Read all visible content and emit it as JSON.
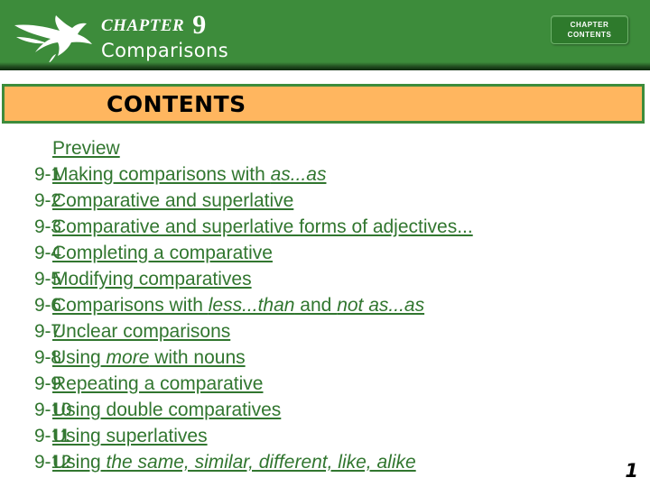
{
  "header": {
    "chapter_word": "CHAPTER",
    "chapter_number": "9",
    "chapter_subject": "Comparisons",
    "background_color": "#3D8C3B",
    "logo_icon": "swallow-bird-icon",
    "contents_button": {
      "line1": "CHAPTER",
      "line2": "CONTENTS"
    }
  },
  "banner": {
    "title": "CONTENTS",
    "background_color": "#FFB65F",
    "border_color": "#3D8C3B"
  },
  "toc": {
    "link_color": "#31762F",
    "items": [
      {
        "number": "",
        "label": "Preview",
        "segments": [
          {
            "text": "Preview",
            "italic": false
          }
        ]
      },
      {
        "number": "9-1",
        "label": "Making comparisons with as...as",
        "segments": [
          {
            "text": "Making comparisons with ",
            "italic": false
          },
          {
            "text": "as...as",
            "italic": true
          }
        ]
      },
      {
        "number": "9-2",
        "label": "Comparative and superlative",
        "segments": [
          {
            "text": "Comparative and superlative",
            "italic": false
          }
        ]
      },
      {
        "number": "9-3",
        "label": "Comparative and superlative forms of adjectives...",
        "segments": [
          {
            "text": "Comparative and superlative forms of adjectives...",
            "italic": false
          }
        ]
      },
      {
        "number": "9-4",
        "label": "Completing a comparative",
        "segments": [
          {
            "text": "Completing a comparative",
            "italic": false
          }
        ]
      },
      {
        "number": "9-5",
        "label": "Modifying comparatives",
        "segments": [
          {
            "text": "Modifying comparatives",
            "italic": false
          }
        ]
      },
      {
        "number": "9-6",
        "label": "Comparisons with less...than and not as...as",
        "segments": [
          {
            "text": "Comparisons with ",
            "italic": false
          },
          {
            "text": "less...than",
            "italic": true
          },
          {
            "text": " and ",
            "italic": false
          },
          {
            "text": "not as...as",
            "italic": true
          }
        ]
      },
      {
        "number": "9-7",
        "label": "Unclear comparisons",
        "segments": [
          {
            "text": "Unclear comparisons",
            "italic": false
          }
        ]
      },
      {
        "number": "9-8",
        "label": "Using more with nouns",
        "segments": [
          {
            "text": "Using ",
            "italic": false
          },
          {
            "text": "more",
            "italic": true
          },
          {
            "text": " with nouns",
            "italic": false
          }
        ]
      },
      {
        "number": "9-9",
        "label": "Repeating a comparative",
        "segments": [
          {
            "text": "Repeating a comparative",
            "italic": false
          }
        ]
      },
      {
        "number": "9-10",
        "label": "Using double comparatives",
        "segments": [
          {
            "text": "Using double comparatives",
            "italic": false
          }
        ]
      },
      {
        "number": "9-11",
        "label": "Using superlatives",
        "segments": [
          {
            "text": "Using superlatives",
            "italic": false
          }
        ]
      },
      {
        "number": "9-12",
        "label": "Using the same, similar, different, like, alike",
        "segments": [
          {
            "text": "Using ",
            "italic": false
          },
          {
            "text": "the same, similar, different, like, alike",
            "italic": true
          }
        ]
      }
    ]
  },
  "footer": {
    "page_number": "1"
  }
}
